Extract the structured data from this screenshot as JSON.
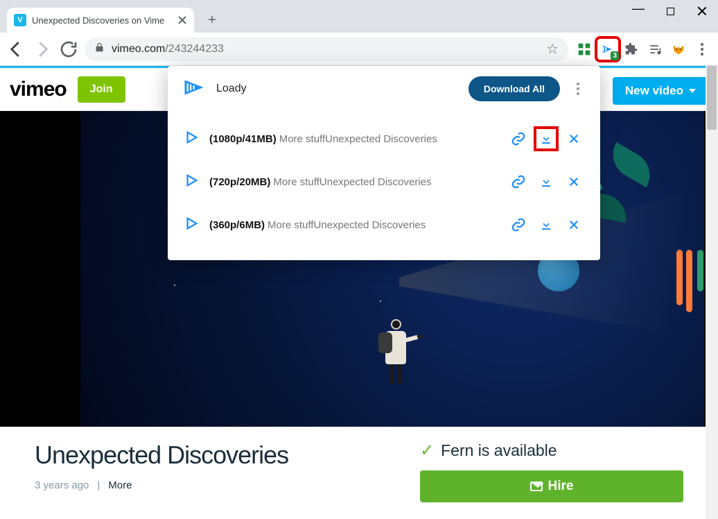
{
  "browser": {
    "tab_title": "Unexpected Discoveries on Vime",
    "url_domain": "vimeo.com",
    "url_path": "/243244233",
    "ext_badge": "3"
  },
  "vimeo": {
    "logo": "vimeo",
    "join": "Join",
    "new_video": "New video"
  },
  "popup": {
    "app": "Loady",
    "download_all": "Download All",
    "items": [
      {
        "quality": "(1080p/41MB)",
        "title": "More stuffUnexpected Discoveries"
      },
      {
        "quality": "(720p/20MB)",
        "title": "More stuffUnexpected Discoveries"
      },
      {
        "quality": "(360p/6MB)",
        "title": "More stuffUnexpected Discoveries"
      }
    ]
  },
  "video": {
    "title": "Unexpected Discoveries",
    "age": "3 years ago",
    "sep": "|",
    "more": "More"
  },
  "sidebar": {
    "avail": "Fern is available",
    "hire": "Hire"
  }
}
